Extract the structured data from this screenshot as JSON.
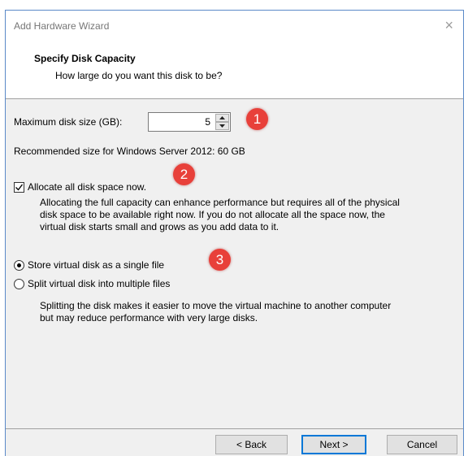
{
  "window": {
    "title": "Add Hardware Wizard",
    "close_glyph": "×"
  },
  "header": {
    "title": "Specify Disk Capacity",
    "subtitle": "How large do you want this disk to be?"
  },
  "disk_size": {
    "label": "Maximum disk size (GB):",
    "value": "5"
  },
  "recommended": "Recommended size for Windows Server 2012: 60 GB",
  "allocate": {
    "label": "Allocate all disk space now.",
    "checked": true,
    "description": [
      "Allocating the full capacity can enhance performance but requires all of the physical",
      "disk space to be available right now. If you do not allocate all the space now, the",
      "virtual disk starts small and grows as you add data to it."
    ]
  },
  "storage": {
    "options": [
      {
        "label": "Store virtual disk as a single file",
        "selected": true
      },
      {
        "label": "Split virtual disk into multiple files",
        "selected": false
      }
    ],
    "description": [
      "Splitting the disk makes it easier to move the virtual machine to another computer",
      "but may reduce performance with very large disks."
    ]
  },
  "badges": [
    "1",
    "2",
    "3"
  ],
  "buttons": {
    "back": "< Back",
    "next": "Next >",
    "cancel": "Cancel"
  },
  "colors": {
    "badge": "#e8403a",
    "default_button_border": "#0078d7",
    "dialog_bg": "#f0f0f0"
  }
}
